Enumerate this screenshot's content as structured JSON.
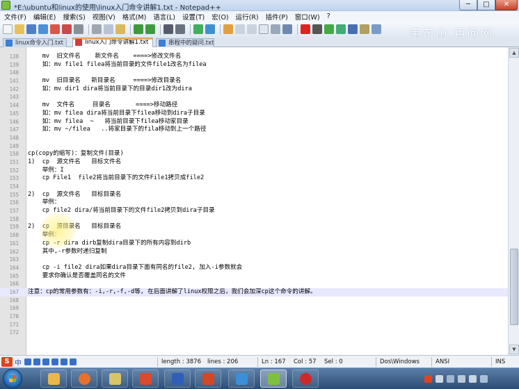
{
  "window": {
    "title": "*E:\\ubuntu和linux的使用\\linux入门命令讲解1.txt - Notepad++",
    "min": "─",
    "max": "□",
    "close": "✕"
  },
  "menu": [
    "文件(F)",
    "编辑(E)",
    "搜索(S)",
    "视图(V)",
    "格式(M)",
    "语言(L)",
    "设置(T)",
    "宏(O)",
    "运行(R)",
    "插件(P)",
    "窗口(W)",
    "?"
  ],
  "watermark": "韦东山 百问网",
  "tabs": [
    {
      "label": "linux命令入门.txt",
      "icon_color": "#3b7fd6"
    },
    {
      "label": "linux入门命令讲解1.txt",
      "icon_color": "#d63b3b"
    },
    {
      "label": "串程中的疑问.txt",
      "icon_color": "#3b7fd6"
    }
  ],
  "editor": {
    "current_line": "167",
    "lines": [
      {
        "n": "138",
        "t": "    mv  旧文件名    新文件名    ====>修改文件名"
      },
      {
        "n": "139",
        "t": "    如：mv file1 filea将当前目录的文件file1改名为filea"
      },
      {
        "n": "140",
        "t": ""
      },
      {
        "n": "141",
        "t": "    mv  旧目录名   新目录名     ====>修改目录名"
      },
      {
        "n": "142",
        "t": "    如：mv dir1 dira将当前目录下的目录dir1改为dira"
      },
      {
        "n": "143",
        "t": ""
      },
      {
        "n": "144",
        "t": "    mv  文件名     目录名       ====>移动路径"
      },
      {
        "n": "145",
        "t": "    如：mv filea dira将当前目录下filea移动到dira子目录"
      },
      {
        "n": "146",
        "t": "    如：mv filea  ~   将当前目录下filea移动家目录"
      },
      {
        "n": "147",
        "t": "    如：mv ~/filea   ..将家目录下的fila移动到上一个路径"
      },
      {
        "n": "148",
        "t": ""
      },
      {
        "n": "149",
        "t": ""
      },
      {
        "n": "150",
        "t": "cp(copy的缩写)：复制文件(目录)"
      },
      {
        "n": "151",
        "t": "1)  cp  源文件名   目标文件名"
      },
      {
        "n": "152",
        "t": "    举例：I"
      },
      {
        "n": "153",
        "t": "    cp File1  file2将当前目录下的文件File1拷贝成file2"
      },
      {
        "n": "154",
        "t": ""
      },
      {
        "n": "155",
        "t": "2)  cp  源文件名   目标目录名"
      },
      {
        "n": "156",
        "t": "    举例："
      },
      {
        "n": "157",
        "t": "    cp file2 dira/将当前目录下的文件file2拷贝到dira子目录"
      },
      {
        "n": "158",
        "t": ""
      },
      {
        "n": "159",
        "t": "2)  cp  源目录名   目标目录名"
      },
      {
        "n": "160",
        "t": "    举例："
      },
      {
        "n": "161",
        "t": "    cp -r dira dirb复制dira目录下的所有内容到dirb"
      },
      {
        "n": "162",
        "t": "    其中,-r参数时递归复制"
      },
      {
        "n": "163",
        "t": ""
      },
      {
        "n": "164",
        "t": "    cp -i file2 dira如果dira目录下面有同名的file2, 加入-i参数就会"
      },
      {
        "n": "165",
        "t": "    要求你确认是否覆盖同名的文件"
      },
      {
        "n": "166",
        "t": ""
      },
      {
        "n": "167",
        "t": "注意：cp的常用参数有：-i,-r,-f,-d等, 在后面讲解了linux权限之后，我们会加深cp这个命令的讲解。"
      },
      {
        "n": "168",
        "t": ""
      },
      {
        "n": "169",
        "t": ""
      },
      {
        "n": "170",
        "t": ""
      },
      {
        "n": "171",
        "t": ""
      },
      {
        "n": "172",
        "t": ""
      }
    ]
  },
  "status": {
    "ime_logo": "S",
    "ime_lang": "中",
    "length": "length : 3876",
    "lines": "lines : 206",
    "ln": "Ln : 167",
    "col": "Col : 57",
    "sel": "Sel : 0",
    "eol": "Dos\\Windows",
    "encoding": "ANSI",
    "mode": "INS"
  },
  "taskbar": {
    "apps": [
      {
        "name": "explorer",
        "color": "#e8b84a"
      },
      {
        "name": "firefox",
        "color": "#e8702a"
      },
      {
        "name": "chat-app",
        "color": "#d8c46a"
      },
      {
        "name": "pdf-reader",
        "color": "#d94a2f"
      },
      {
        "name": "word",
        "color": "#2f5eb8"
      },
      {
        "name": "powerpoint",
        "color": "#d24726"
      },
      {
        "name": "text-tool",
        "color": "#3a8fd8"
      },
      {
        "name": "notepad-plus-plus",
        "color": "#7fbf3f"
      },
      {
        "name": "recorder",
        "color": "#c92a2a"
      }
    ]
  }
}
